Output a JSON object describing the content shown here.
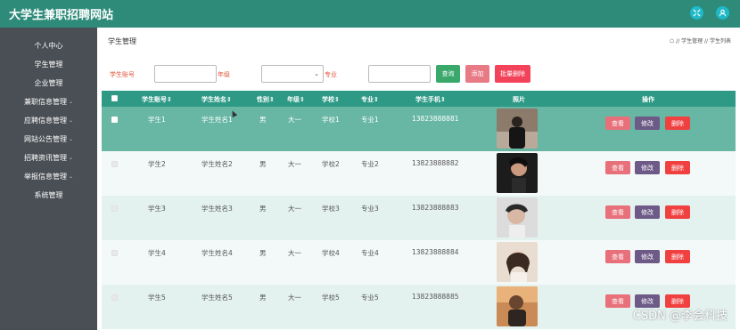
{
  "app": {
    "title": "大学生兼职招聘网站"
  },
  "topbar": {
    "icons": [
      "fullscreen-icon",
      "user-icon"
    ]
  },
  "sidebar": {
    "items": [
      {
        "label": "个人中心",
        "expandable": false
      },
      {
        "label": "学生管理",
        "expandable": false
      },
      {
        "label": "企业管理",
        "expandable": false
      },
      {
        "label": "兼职信息管理",
        "expandable": true
      },
      {
        "label": "应聘信息管理",
        "expandable": true
      },
      {
        "label": "网站公告管理",
        "expandable": true
      },
      {
        "label": "招聘资讯管理",
        "expandable": true
      },
      {
        "label": "举报信息管理",
        "expandable": true
      },
      {
        "label": "系统管理",
        "expandable": false
      }
    ]
  },
  "header": {
    "page_title": "学生管理",
    "breadcrumb": "☖ // 学生管理 // 学生列表"
  },
  "filters": {
    "student_no_label": "学生账号",
    "student_no_value": "",
    "grade_label": "年级",
    "grade_value": "",
    "major_label": "专业",
    "major_value": "",
    "search_label": "查询",
    "add_label": "添加",
    "batch_delete_label": "批量删除",
    "colors": {
      "search": "#3aa86b",
      "add": "#e87a86",
      "batch_delete": "#f2435b",
      "label": "#e0543a"
    }
  },
  "table": {
    "header_color": "#2e9a86",
    "columns": [
      "学生账号",
      "学生姓名",
      "性别",
      "年级",
      "学校",
      "专业",
      "学生手机",
      "照片",
      "操作"
    ],
    "rows": [
      {
        "account": "学生1",
        "name": "学生姓名1",
        "gender": "男",
        "grade": "大一",
        "school": "学校1",
        "major": "专业1",
        "phone": "13823888881",
        "photo": "photo-man-dark-coat"
      },
      {
        "account": "学生2",
        "name": "学生姓名2",
        "gender": "男",
        "grade": "大一",
        "school": "学校2",
        "major": "专业2",
        "phone": "13823888882",
        "photo": "photo-man-profile"
      },
      {
        "account": "学生3",
        "name": "学生姓名3",
        "gender": "男",
        "grade": "大一",
        "school": "学校3",
        "major": "专业3",
        "phone": "13823888883",
        "photo": "photo-man-light"
      },
      {
        "account": "学生4",
        "name": "学生姓名4",
        "gender": "男",
        "grade": "大一",
        "school": "学校4",
        "major": "专业4",
        "phone": "13823888884",
        "photo": "photo-woman"
      },
      {
        "account": "学生5",
        "name": "学生姓名5",
        "gender": "男",
        "grade": "大一",
        "school": "学校5",
        "major": "专业5",
        "phone": "13823888885",
        "photo": "photo-man-sunset"
      }
    ],
    "actions": {
      "view": "查看",
      "edit": "修改",
      "delete": "删除"
    }
  },
  "watermark": "CSDN @李会科技"
}
